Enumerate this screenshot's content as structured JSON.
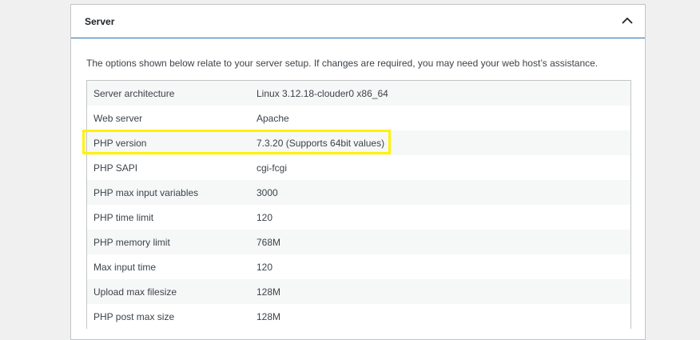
{
  "section": {
    "title": "Server",
    "toggle_icon": "chevron-up-icon",
    "description": "The options shown below relate to your server setup. If changes are required, you may need your web host’s assistance."
  },
  "rows": [
    {
      "label": "Server architecture",
      "value": "Linux 3.12.18-clouder0 x86_64"
    },
    {
      "label": "Web server",
      "value": "Apache"
    },
    {
      "label": "PHP version",
      "value": "7.3.20 (Supports 64bit values)"
    },
    {
      "label": "PHP SAPI",
      "value": "cgi-fcgi"
    },
    {
      "label": "PHP max input variables",
      "value": "3000"
    },
    {
      "label": "PHP time limit",
      "value": "120"
    },
    {
      "label": "PHP memory limit",
      "value": "768M"
    },
    {
      "label": "Max input time",
      "value": "120"
    },
    {
      "label": "Upload max filesize",
      "value": "128M"
    },
    {
      "label": "PHP post max size",
      "value": "128M"
    }
  ],
  "colors": {
    "highlight": "#fff200",
    "header_border": "#2271b1",
    "stripe": "#f6f7f7"
  }
}
